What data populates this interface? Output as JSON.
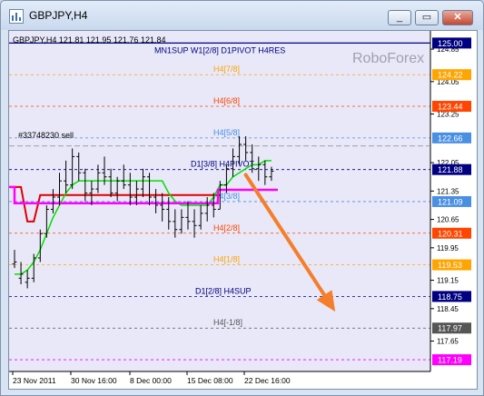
{
  "window": {
    "title": "GBPJPY,H4",
    "minimize_label": "_",
    "restore_label": "▭",
    "close_label": "✕"
  },
  "chart": {
    "info_line": "GBPJPY,H4  121.81 121.95 121.76 121.84",
    "levels_title": "MN1SUP W1[2/8] D1PIVOT H4RES",
    "watermark": "RoboForex",
    "order_label": "#33748230 sell",
    "background": "#e8e8f8"
  },
  "chart_data": {
    "type": "line",
    "symbol": "GBPJPY",
    "timeframe": "H4",
    "ohlc_readout": {
      "open": 121.81,
      "high": 121.95,
      "low": 121.76,
      "close": 121.84
    },
    "ylim": [
      116.9,
      125.3
    ],
    "price_axis_ticks": [
      {
        "value": 124.85,
        "label": "124.85"
      },
      {
        "value": 124.05,
        "label": "124.05"
      },
      {
        "value": 123.25,
        "label": "123.25"
      },
      {
        "value": 122.05,
        "label": "122.05"
      },
      {
        "value": 121.35,
        "label": "121.35"
      },
      {
        "value": 120.65,
        "label": "120.65"
      },
      {
        "value": 119.95,
        "label": "119.95"
      },
      {
        "value": 119.15,
        "label": "119.15"
      },
      {
        "value": 118.45,
        "label": "118.45"
      },
      {
        "value": 117.65,
        "label": "117.65"
      }
    ],
    "time_axis_labels": [
      "23 Nov 2011",
      "30 Nov 16:00",
      "8 Dec 00:00",
      "15 Dec 08:00",
      "22 Dec 16:00"
    ],
    "murrey_levels": [
      {
        "price": 125.0,
        "label": "MN1SUP W1[2/8] D1PIVOT H4RES",
        "color": "#000080",
        "style": "solid"
      },
      {
        "price": 124.22,
        "label": "H4[7/8]",
        "color": "#ffa500",
        "style": "dashed"
      },
      {
        "price": 123.44,
        "label": "H4[6/8]",
        "color": "#ff4500",
        "style": "dashed"
      },
      {
        "price": 122.66,
        "label": "H4[5/8]",
        "color": "#4a90e2",
        "style": "dashed"
      },
      {
        "price": 121.88,
        "label": "D1[3/8] H4PIVOT",
        "color": "#000080",
        "style": "dashed"
      },
      {
        "price": 121.09,
        "label": "H4[3/8]",
        "color": "#4a90e2",
        "style": "dashed"
      },
      {
        "price": 120.31,
        "label": "H4[2/8]",
        "color": "#ff4500",
        "style": "dashed"
      },
      {
        "price": 119.53,
        "label": "H4[1/8]",
        "color": "#ffa500",
        "style": "dashed"
      },
      {
        "price": 118.75,
        "label": "D1[2/8] H4SUP",
        "color": "#000080",
        "style": "dashed"
      },
      {
        "price": 117.97,
        "label": "H4[-1/8]",
        "color": "#555555",
        "style": "dashed"
      },
      {
        "price": 117.19,
        "label": "",
        "color": "#ff00ff",
        "style": "dashed"
      }
    ],
    "price_badges": [
      {
        "value": "125.00",
        "color": "#000080"
      },
      {
        "value": "124.22",
        "color": "#ffa500"
      },
      {
        "value": "123.44",
        "color": "#ff4500"
      },
      {
        "value": "122.66",
        "color": "#4a90e2"
      },
      {
        "value": "121.88",
        "color": "#000080"
      },
      {
        "value": "121.09",
        "color": "#4a90e2"
      },
      {
        "value": "120.31",
        "color": "#ff4500"
      },
      {
        "value": "119.53",
        "color": "#ffa500"
      },
      {
        "value": "118.75",
        "color": "#000080"
      },
      {
        "value": "117.97",
        "color": "#555555"
      },
      {
        "value": "117.19",
        "color": "#ff00ff"
      }
    ],
    "bars": [
      [
        119.9,
        119.45,
        119.55,
        119.6
      ],
      [
        119.6,
        119.05,
        119.2,
        119.3
      ],
      [
        119.4,
        118.95,
        119.1,
        119.2
      ],
      [
        119.8,
        119.1,
        119.2,
        119.7
      ],
      [
        120.4,
        119.6,
        119.7,
        120.3
      ],
      [
        121.0,
        120.2,
        120.3,
        120.9
      ],
      [
        121.4,
        120.8,
        120.9,
        121.2
      ],
      [
        121.8,
        121.0,
        121.2,
        121.6
      ],
      [
        122.1,
        121.3,
        121.6,
        121.5
      ],
      [
        122.4,
        121.4,
        121.5,
        122.2
      ],
      [
        122.3,
        121.6,
        122.2,
        121.8
      ],
      [
        121.9,
        121.1,
        121.8,
        121.3
      ],
      [
        121.6,
        121.0,
        121.3,
        121.4
      ],
      [
        122.0,
        121.3,
        121.4,
        121.8
      ],
      [
        122.2,
        121.5,
        121.8,
        121.7
      ],
      [
        121.9,
        121.2,
        121.7,
        121.3
      ],
      [
        121.7,
        121.1,
        121.3,
        121.6
      ],
      [
        122.0,
        121.4,
        121.6,
        121.5
      ],
      [
        121.8,
        121.0,
        121.5,
        121.2
      ],
      [
        121.6,
        121.0,
        121.2,
        121.4
      ],
      [
        121.9,
        121.2,
        121.4,
        121.7
      ],
      [
        121.8,
        121.0,
        121.7,
        121.2
      ],
      [
        121.4,
        120.8,
        121.2,
        121.0
      ],
      [
        121.3,
        120.6,
        121.0,
        120.9
      ],
      [
        121.2,
        120.4,
        120.9,
        120.6
      ],
      [
        120.9,
        120.2,
        120.6,
        120.4
      ],
      [
        120.9,
        120.3,
        120.4,
        120.7
      ],
      [
        121.1,
        120.4,
        120.7,
        120.6
      ],
      [
        120.9,
        120.2,
        120.6,
        120.5
      ],
      [
        121.0,
        120.4,
        120.5,
        120.8
      ],
      [
        121.2,
        120.6,
        120.8,
        121.0
      ],
      [
        121.3,
        120.7,
        121.0,
        120.9
      ],
      [
        121.6,
        120.9,
        120.9,
        121.5
      ],
      [
        122.0,
        121.3,
        121.5,
        121.9
      ],
      [
        122.4,
        121.7,
        121.9,
        122.2
      ],
      [
        122.7,
        122.0,
        122.2,
        122.5
      ],
      [
        122.7,
        122.1,
        122.5,
        122.3
      ],
      [
        122.5,
        121.8,
        122.3,
        121.9
      ],
      [
        122.2,
        121.6,
        121.9,
        122.0
      ],
      [
        122.1,
        121.5,
        122.0,
        121.7
      ],
      [
        121.95,
        121.6,
        121.7,
        121.84
      ]
    ],
    "ma_green": [
      119.3,
      119.3,
      119.4,
      119.6,
      119.9,
      120.3,
      120.7,
      121.0,
      121.3,
      121.5,
      121.6,
      121.6,
      121.6,
      121.6,
      121.6,
      121.6,
      121.6,
      121.6,
      121.6,
      121.6,
      121.6,
      121.6,
      121.6,
      121.6,
      121.3,
      121.1,
      121.0,
      121.0,
      121.0,
      121.0,
      121.0,
      121.2,
      121.5,
      121.5,
      121.7,
      121.8,
      121.9,
      122.0,
      122.0,
      122.1,
      122.1
    ],
    "ma_red": [
      121.45,
      121.45,
      120.6,
      120.6,
      121.25,
      121.25,
      121.25,
      121.25,
      121.25,
      121.25,
      121.25,
      121.25,
      121.25,
      121.25,
      121.25,
      121.25,
      121.25,
      121.25,
      121.25,
      121.25,
      121.25,
      121.25,
      121.25,
      121.25,
      121.25,
      121.25,
      121.25,
      121.25,
      121.25,
      121.25,
      121.25,
      121.25,
      121.25
    ],
    "ma_magenta_level": 121.05,
    "ma_magenta_level_2": 121.38,
    "sell_order_level": 122.46,
    "arrow": {
      "from": [
        36,
        121.75
      ],
      "to": [
        49,
        118.6
      ],
      "color": "#f57e2b"
    }
  }
}
